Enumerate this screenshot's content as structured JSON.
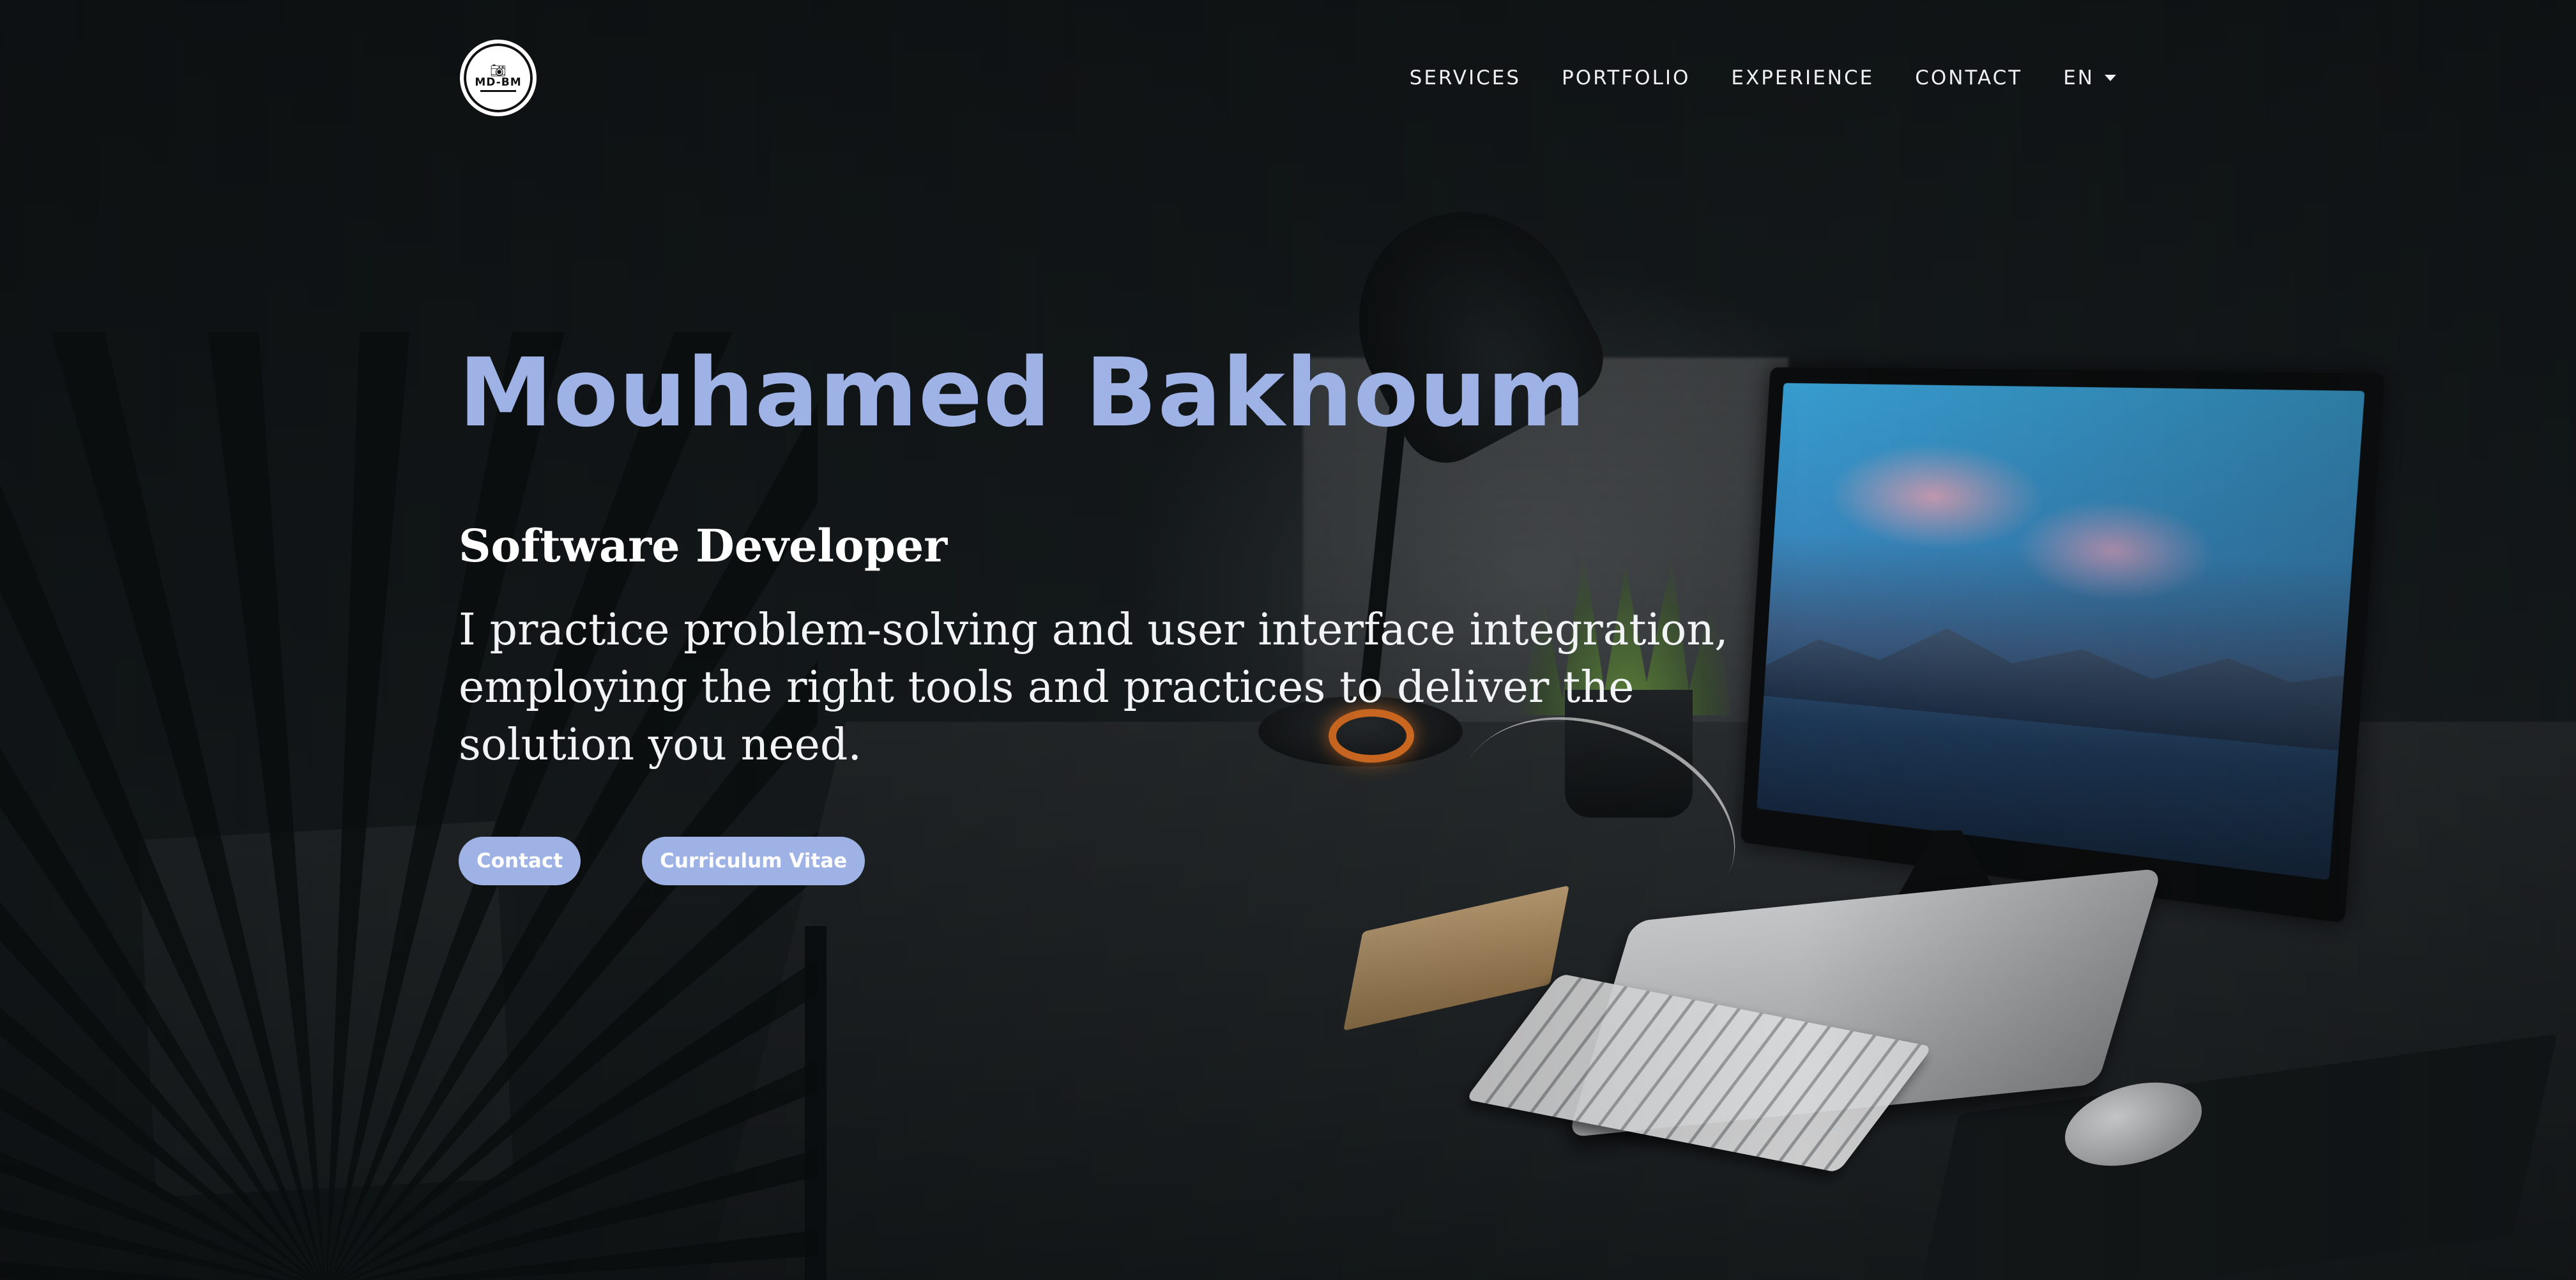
{
  "brand": {
    "logo_text": "MD-BM",
    "logo_icon": "camera-icon"
  },
  "nav": {
    "items": [
      {
        "label": "SERVICES"
      },
      {
        "label": "PORTFOLIO"
      },
      {
        "label": "EXPERIENCE"
      },
      {
        "label": "CONTACT"
      }
    ],
    "language": {
      "label": "EN",
      "icon": "caret-down-icon"
    }
  },
  "hero": {
    "name": "Mouhamed Bakhoum",
    "role": "Software Developer",
    "tagline": "I practice problem-solving and user interface integration, employing the right tools and practices to deliver the solution you need.",
    "buttons": {
      "contact": "Contact",
      "cv": "Curriculum Vitae"
    }
  },
  "colors": {
    "accent": "#9fb2e6",
    "background": "#121617",
    "text": "#ffffff"
  }
}
